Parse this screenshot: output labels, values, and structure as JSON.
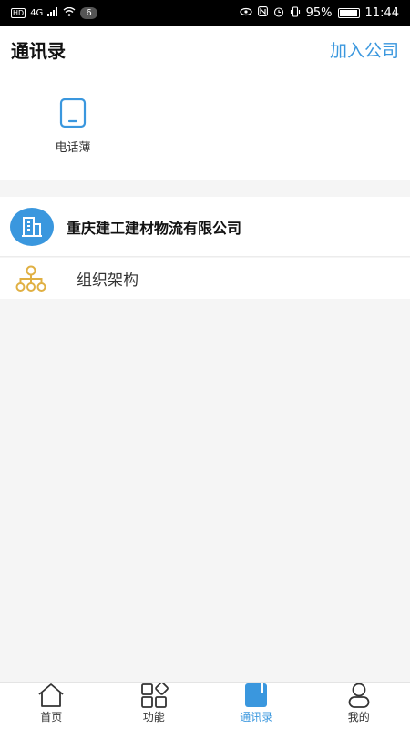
{
  "status_bar": {
    "left": {
      "hd": "HD",
      "network": "4G",
      "notification_count": "6"
    },
    "right": {
      "battery": "95%",
      "time": "11:44"
    }
  },
  "header": {
    "title": "通讯录",
    "action": "加入公司"
  },
  "quick_actions": [
    {
      "label": "电话薄",
      "icon": "phone-book-icon"
    }
  ],
  "company": {
    "name": "重庆建工建材物流有限公司",
    "logo_color": "#3a97de"
  },
  "org": {
    "label": "组织架构"
  },
  "tabbar": {
    "items": [
      {
        "label": "首页",
        "icon": "home-icon"
      },
      {
        "label": "功能",
        "icon": "grid-icon"
      },
      {
        "label": "通讯录",
        "icon": "contacts-icon",
        "active": true
      },
      {
        "label": "我的",
        "icon": "person-icon"
      }
    ]
  },
  "colors": {
    "accent": "#3a97de",
    "org_icon": "#e0b043",
    "background": "#f5f5f5"
  }
}
